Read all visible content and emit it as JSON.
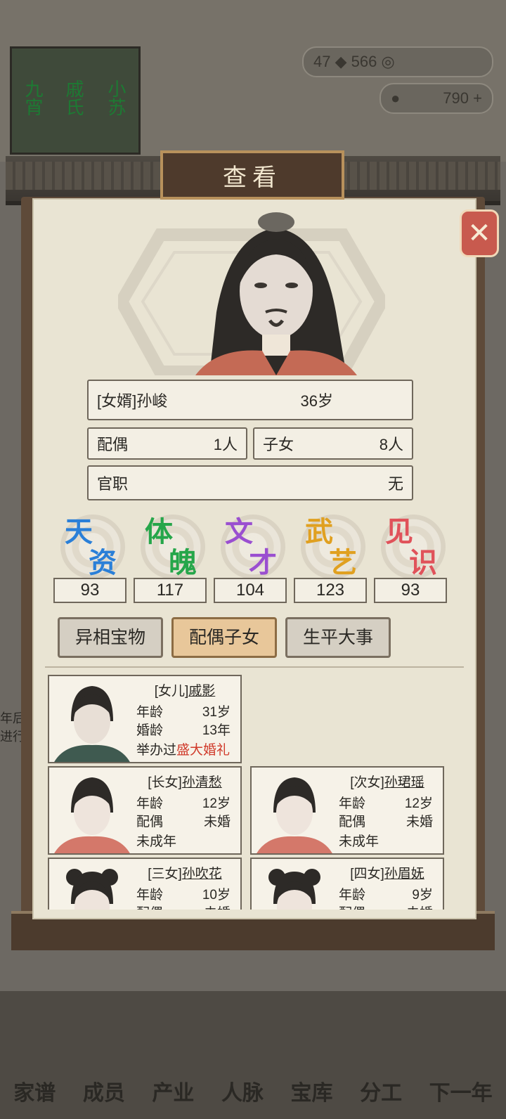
{
  "background": {
    "book_titles": [
      "九宵",
      "戚氏",
      "小苏"
    ],
    "resources": {
      "gem_count": "47",
      "coin_count": "566",
      "gold_count": "790"
    },
    "nav_items": [
      "家谱",
      "成员",
      "产业",
      "人脉",
      "宝库",
      "分工",
      "下一年"
    ],
    "side_text": [
      "年后",
      "进行"
    ]
  },
  "panel": {
    "title": "查看",
    "close_icon": "close-x-icon",
    "person": {
      "name": "[女婿]孙峻",
      "age": "36岁",
      "spouse_label": "配偶",
      "spouse_value": "1人",
      "children_label": "子女",
      "children_value": "8人",
      "office_label": "官职",
      "office_value": "无"
    },
    "stats": [
      {
        "c1": "天",
        "c2": "资",
        "value": "93",
        "color": "#2a7fd8"
      },
      {
        "c1": "体",
        "c2": "魄",
        "value": "117",
        "color": "#26a64a"
      },
      {
        "c1": "文",
        "c2": "才",
        "value": "104",
        "color": "#9a4fd0"
      },
      {
        "c1": "武",
        "c2": "艺",
        "value": "123",
        "color": "#e0a020"
      },
      {
        "c1": "见",
        "c2": "识",
        "value": "93",
        "color": "#e0525a"
      }
    ],
    "tabs": [
      "异相宝物",
      "配偶子女",
      "生平大事"
    ],
    "active_tab": 1,
    "members": [
      {
        "prefix": "[女儿]",
        "name": "戚影",
        "age_label": "年龄",
        "age": "31岁",
        "r2_label": "婚龄",
        "r2_value": "13年",
        "wed_prefix": "举办过",
        "wed_highlight": "盛大婚礼"
      },
      {
        "prefix": "[长女]",
        "name": "孙清愁",
        "age_label": "年龄",
        "age": "12岁",
        "r2_label": "配偶",
        "r2_value": "未婚",
        "status": "未成年"
      },
      {
        "prefix": "[次女]",
        "name": "孙珺瑶",
        "age_label": "年龄",
        "age": "12岁",
        "r2_label": "配偶",
        "r2_value": "未婚",
        "status": "未成年"
      },
      {
        "prefix": "[三女]",
        "name": "孙吹花",
        "age_label": "年龄",
        "age": "10岁",
        "r2_label": "配偶",
        "r2_value": "未婚"
      },
      {
        "prefix": "[四女]",
        "name": "孙眉妩",
        "age_label": "年龄",
        "age": "9岁",
        "r2_label": "配偶",
        "r2_value": "未婚"
      }
    ]
  }
}
